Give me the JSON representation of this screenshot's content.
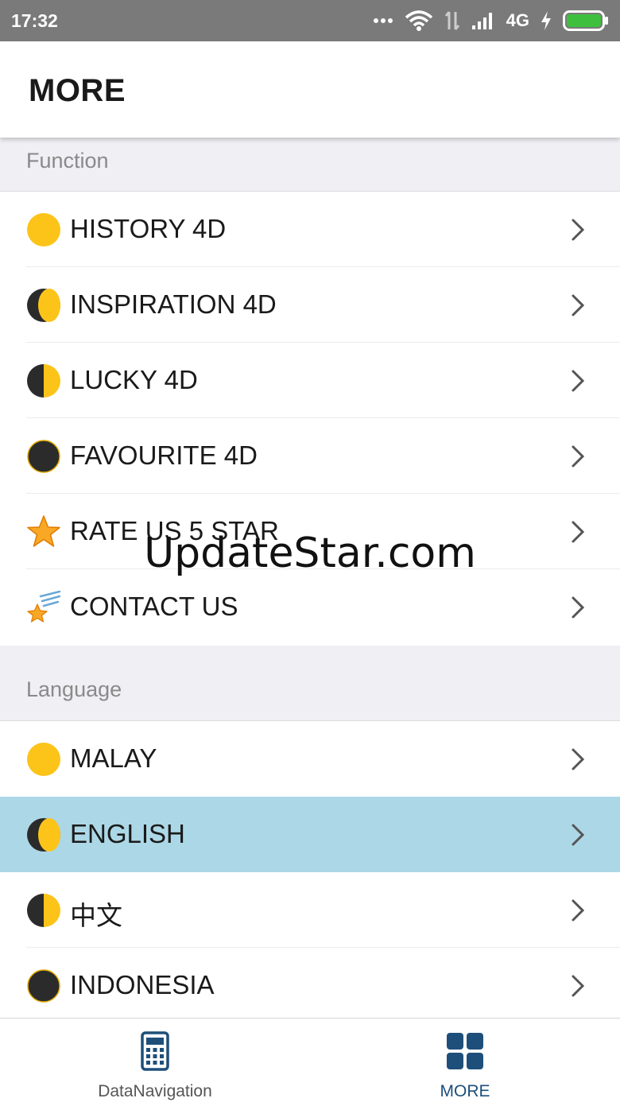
{
  "status_bar": {
    "time": "17:32",
    "network": "4G"
  },
  "header": {
    "title": "MORE"
  },
  "function_section": {
    "label": "Function",
    "items": [
      {
        "label": "HISTORY 4D",
        "icon": "full-moon-icon"
      },
      {
        "label": "INSPIRATION 4D",
        "icon": "crescent-moon-icon"
      },
      {
        "label": "LUCKY 4D",
        "icon": "half-moon-icon"
      },
      {
        "label": "FAVOURITE 4D",
        "icon": "new-moon-icon"
      },
      {
        "label": "RATE US 5 STAR",
        "icon": "star-icon"
      },
      {
        "label": "CONTACT US",
        "icon": "shooting-star-icon"
      }
    ]
  },
  "language_section": {
    "label": "Language",
    "items": [
      {
        "label": "MALAY",
        "icon": "full-moon-icon"
      },
      {
        "label": "ENGLISH",
        "icon": "crescent-moon-icon",
        "selected": true
      },
      {
        "label": "中文",
        "icon": "half-moon-icon"
      },
      {
        "label": "INDONESIA",
        "icon": "new-moon-icon"
      }
    ]
  },
  "watermark": "UpdateStar.com",
  "bottom_nav": {
    "tabs": [
      {
        "label": "DataNavigation",
        "icon": "calculator-icon"
      },
      {
        "label": "MORE",
        "icon": "grid-icon",
        "selected": true
      }
    ]
  },
  "colors": {
    "moon_yellow": "#fcc419",
    "moon_dark": "#2b2b2b",
    "selected_row": "#acd7e6",
    "nav_accent": "#1e4f7a"
  }
}
